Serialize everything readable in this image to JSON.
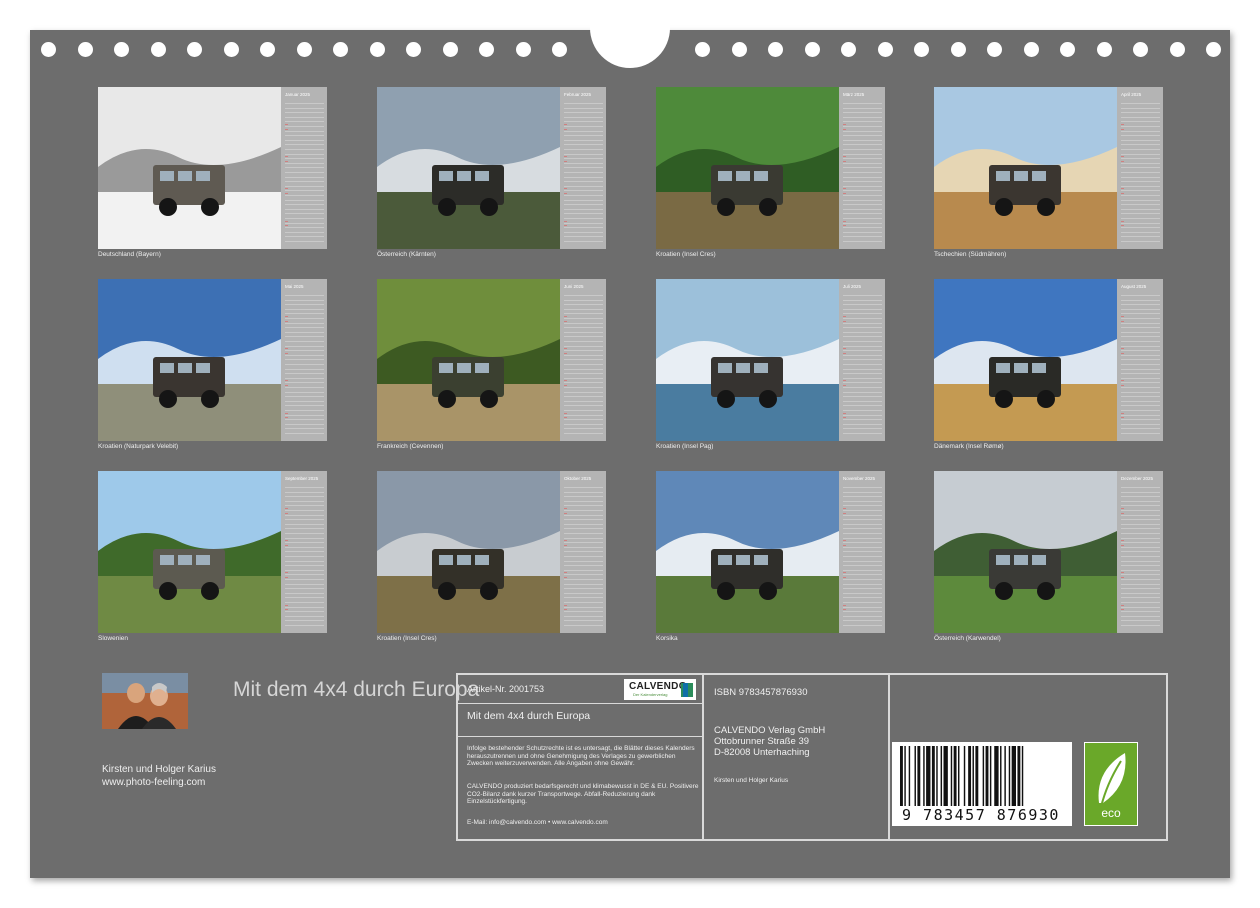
{
  "calendar_tiles": [
    {
      "month": "Januar 2025",
      "caption": "Deutschland (Bayern)",
      "scene": "snow"
    },
    {
      "month": "Februar 2025",
      "caption": "Österreich (Kärnten)",
      "scene": "mountain"
    },
    {
      "month": "März 2025",
      "caption": "Kroatien (Insel Cres)",
      "scene": "forest"
    },
    {
      "month": "April 2025",
      "caption": "Tschechien (Südmähren)",
      "scene": "field"
    },
    {
      "month": "Mai 2025",
      "caption": "Kroatien (Naturpark Velebit)",
      "scene": "rock"
    },
    {
      "month": "Juni 2025",
      "caption": "Frankreich (Cevennen)",
      "scene": "trees"
    },
    {
      "month": "Juli 2025",
      "caption": "Kroatien (Insel Pag)",
      "scene": "sea"
    },
    {
      "month": "August 2025",
      "caption": "Dänemark (Insel Rømø)",
      "scene": "beach"
    },
    {
      "month": "September 2025",
      "caption": "Slowenien",
      "scene": "birch"
    },
    {
      "month": "Oktober 2025",
      "caption": "Kroatien (Insel Cres)",
      "scene": "hill"
    },
    {
      "month": "November 2025",
      "caption": "Korsika",
      "scene": "coast"
    },
    {
      "month": "Dezember 2025",
      "caption": "Österreich (Karwendel)",
      "scene": "alps"
    }
  ],
  "title": "Mit dem 4x4 durch Europa",
  "authors": {
    "names": "Kirsten und Holger Karius",
    "website": "www.photo-feeling.com"
  },
  "info": {
    "article": "Artikel-Nr. 2001753",
    "product_title": "Mit dem 4x4 durch Europa",
    "legal_text": "Infolge bestehender Schutzrechte ist es untersagt, die Blätter dieses Kalenders herauszutrennen und ohne Genehmigung des Verlages zu gewerblichen Zwecken weiterzuverwenden. Alle Angaben ohne Gewähr.",
    "eco_text": "CALVENDO produziert bedarfsgerecht und klimabewusst in DE & EU. Positivere CO2-Bilanz dank kurzer Transportwege. Abfall-Reduzierung dank Einzelstückfertigung.",
    "contact": "E-Mail: info@calvendo.com • www.calvendo.com",
    "isbn": "ISBN 9783457876930",
    "publisher_name": "CALVENDO Verlag GmbH",
    "publisher_street": "Ottobrunner Straße 39",
    "publisher_city": "D-82008 Unterhaching",
    "photographers": "Kirsten und Holger Karius",
    "barcode_number": "9 783457 876930",
    "logo_name": "CALVENDO",
    "logo_sub": "Der Kalenderverlag",
    "eco_label": "eco"
  },
  "colors": {
    "background": "#6d6d6d",
    "calendar_strip": "#b4b4b4",
    "eco_green": "#6aa829"
  }
}
